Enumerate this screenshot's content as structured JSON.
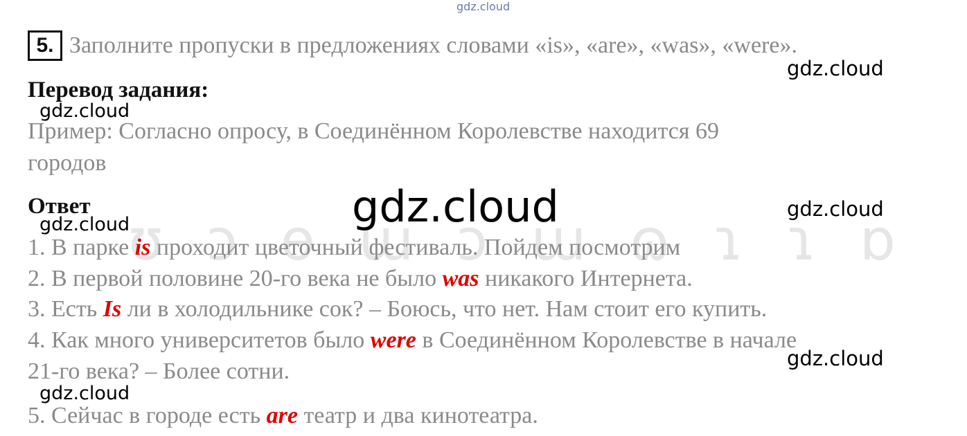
{
  "watermarks": {
    "top": "gdz.cloud",
    "small": "gdz.cloud",
    "center": "gdz.cloud"
  },
  "task": {
    "number": "5.",
    "instruction": "Заполните пропуски в предложениях словами «is», «are», «was», «were»."
  },
  "translation": {
    "heading": "Перевод задания:",
    "example_line1": "Пример: Согласно опросу, в Соединённом Королевстве находится 69",
    "example_line2": "городов"
  },
  "answer": {
    "heading": "Ответ",
    "items": [
      {
        "before": "1. В парке ",
        "word": "is",
        "after": " проходит цветочный фестиваль. Пойдем посмотрим"
      },
      {
        "before": "2. В первой половине 20-го века не было ",
        "word": "was",
        "after": " никакого Интернета."
      },
      {
        "before": "3. Есть ",
        "word": "Is",
        "after": " ли в холодильнике сок? – Боюсь, что нет. Нам стоит его купить."
      },
      {
        "before": "4. Как много университетов было ",
        "word": "were",
        "after": " в Соединённом Королевстве в начале"
      },
      {
        "line2": "21-го века? – Более сотни."
      },
      {
        "before": "5. Сейчас в городе есть ",
        "word": "are",
        "after": " театр и два кинотеатра."
      }
    ]
  },
  "colors": {
    "answer_word": "#e00000",
    "text_gray": "#8a8a8a",
    "heading": "#111111"
  }
}
